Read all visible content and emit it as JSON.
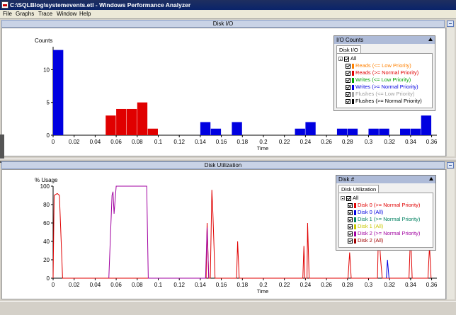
{
  "window": {
    "title": "C:\\SQLBlog\\systemevents.etl - Windows Performance Analyzer"
  },
  "menu": [
    "File",
    "Graphs",
    "Trace",
    "Window",
    "Help"
  ],
  "colors": {
    "reads_low": "#ff8000",
    "reads_normal": "#e00000",
    "writes_low": "#00a000",
    "writes_normal": "#0000e0",
    "flushes_low": "#a0a0a0",
    "flushes_normal": "#000000"
  },
  "panels": {
    "disk_io": {
      "title": "Disk I/O",
      "legend": {
        "header": "I/O Counts",
        "tab": "Disk I/O",
        "root": "All",
        "items": [
          {
            "label": "Reads (<= Low Priority)",
            "color": "#ff8000"
          },
          {
            "label": "Reads (>= Normal Priority)",
            "color": "#e00000"
          },
          {
            "label": "Writes (<= Low Priority)",
            "color": "#00a000"
          },
          {
            "label": "Writes (>= Normal Priority)",
            "color": "#0000e0"
          },
          {
            "label": "Flushes (<= Low Priority)",
            "color": "#a0a0a0"
          },
          {
            "label": "Flushes (>= Normal Priority)",
            "color": "#000000"
          }
        ]
      }
    },
    "disk_util": {
      "title": "Disk Utilization",
      "legend": {
        "header": "Disk #",
        "tab": "Disk Utilization",
        "root": "All",
        "items": [
          {
            "label": "Disk 0 (>= Normal Priority)",
            "color": "#e00000"
          },
          {
            "label": "Disk 0 (All)",
            "color": "#0000e0"
          },
          {
            "label": "Disk 1 (>= Normal Priority)",
            "color": "#008060"
          },
          {
            "label": "Disk 1 (All)",
            "color": "#c8c800"
          },
          {
            "label": "Disk 2 (>= Normal Priority)",
            "color": "#a000a0"
          },
          {
            "label": "Disk 2 (All)",
            "color": "#a00000"
          }
        ]
      }
    }
  },
  "chart_data": [
    {
      "type": "bar",
      "title": "Disk I/O",
      "ylabel": "Counts",
      "xlabel": "Time",
      "xlim": [
        0,
        0.365
      ],
      "ylim": [
        0,
        13.5
      ],
      "yticks": [
        0,
        5,
        10
      ],
      "xticks": [
        "0",
        "0.02",
        "0.04",
        "0.06",
        "0.08",
        "0.1",
        "0.12",
        "0.14",
        "0.16",
        "0.18",
        "0.2",
        "0.22",
        "0.24",
        "0.26",
        "0.28",
        "0.3",
        "0.32",
        "0.34",
        "0.36"
      ],
      "bin_width": 0.01,
      "series": [
        {
          "name": "Reads (>= Normal Priority)",
          "color": "#e00000",
          "bins": [
            [
              0.05,
              3
            ],
            [
              0.06,
              4
            ],
            [
              0.07,
              4
            ],
            [
              0.08,
              5
            ],
            [
              0.09,
              1
            ]
          ]
        },
        {
          "name": "Writes (>= Normal Priority)",
          "color": "#0000e0",
          "bins": [
            [
              0.0,
              13
            ],
            [
              0.14,
              2
            ],
            [
              0.15,
              1
            ],
            [
              0.17,
              2
            ],
            [
              0.23,
              1
            ],
            [
              0.24,
              2
            ],
            [
              0.27,
              1
            ],
            [
              0.28,
              1
            ],
            [
              0.3,
              1
            ],
            [
              0.31,
              1
            ],
            [
              0.33,
              1
            ],
            [
              0.34,
              1
            ],
            [
              0.35,
              3
            ]
          ]
        }
      ]
    },
    {
      "type": "line",
      "title": "Disk Utilization",
      "ylabel": "% Usage",
      "xlabel": "Time",
      "xlim": [
        0,
        0.365
      ],
      "ylim": [
        0,
        100
      ],
      "yticks": [
        0,
        20,
        40,
        60,
        80,
        100
      ],
      "xticks": [
        "0",
        "0.02",
        "0.04",
        "0.06",
        "0.08",
        "0.1",
        "0.12",
        "0.14",
        "0.16",
        "0.18",
        "0.2",
        "0.22",
        "0.24",
        "0.26",
        "0.28",
        "0.3",
        "0.32",
        "0.34",
        "0.36"
      ],
      "series": [
        {
          "name": "Disk 0 (>= Normal Priority)",
          "color": "#e00000",
          "points": [
            [
              0,
              0
            ],
            [
              0.001,
              90
            ],
            [
              0.004,
              92
            ],
            [
              0.006,
              90
            ],
            [
              0.009,
              0
            ],
            [
              0.1455,
              0
            ],
            [
              0.1465,
              60
            ],
            [
              0.148,
              0
            ],
            [
              0.1495,
              0
            ],
            [
              0.151,
              96
            ],
            [
              0.152,
              70
            ],
            [
              0.154,
              0
            ],
            [
              0.1745,
              0
            ],
            [
              0.1755,
              40
            ],
            [
              0.177,
              0
            ],
            [
              0.2375,
              0
            ],
            [
              0.2385,
              35
            ],
            [
              0.2395,
              0
            ],
            [
              0.2415,
              0
            ],
            [
              0.242,
              60
            ],
            [
              0.2435,
              0
            ],
            [
              0.2805,
              0
            ],
            [
              0.282,
              28
            ],
            [
              0.2835,
              0
            ],
            [
              0.3085,
              0
            ],
            [
              0.3095,
              55
            ],
            [
              0.3115,
              20
            ],
            [
              0.313,
              0
            ],
            [
              0.3385,
              0
            ],
            [
              0.34,
              50
            ],
            [
              0.3415,
              0
            ],
            [
              0.3565,
              0
            ],
            [
              0.358,
              35
            ],
            [
              0.3595,
              0
            ]
          ]
        },
        {
          "name": "Disk 0 (All)",
          "color": "#0000e0",
          "points": [
            [
              0.317,
              0
            ],
            [
              0.318,
              20
            ],
            [
              0.3195,
              0
            ]
          ]
        },
        {
          "name": "Disk 2 (>= Normal Priority)",
          "color": "#a000a0",
          "points": [
            [
              0.053,
              0
            ],
            [
              0.056,
              90
            ],
            [
              0.057,
              94
            ],
            [
              0.058,
              70
            ],
            [
              0.06,
              100
            ],
            [
              0.064,
              100
            ],
            [
              0.086,
              100
            ],
            [
              0.089,
              100
            ],
            [
              0.0905,
              0
            ],
            [
              0.145,
              0
            ],
            [
              0.1465,
              55
            ],
            [
              0.148,
              0
            ]
          ]
        }
      ]
    }
  ]
}
